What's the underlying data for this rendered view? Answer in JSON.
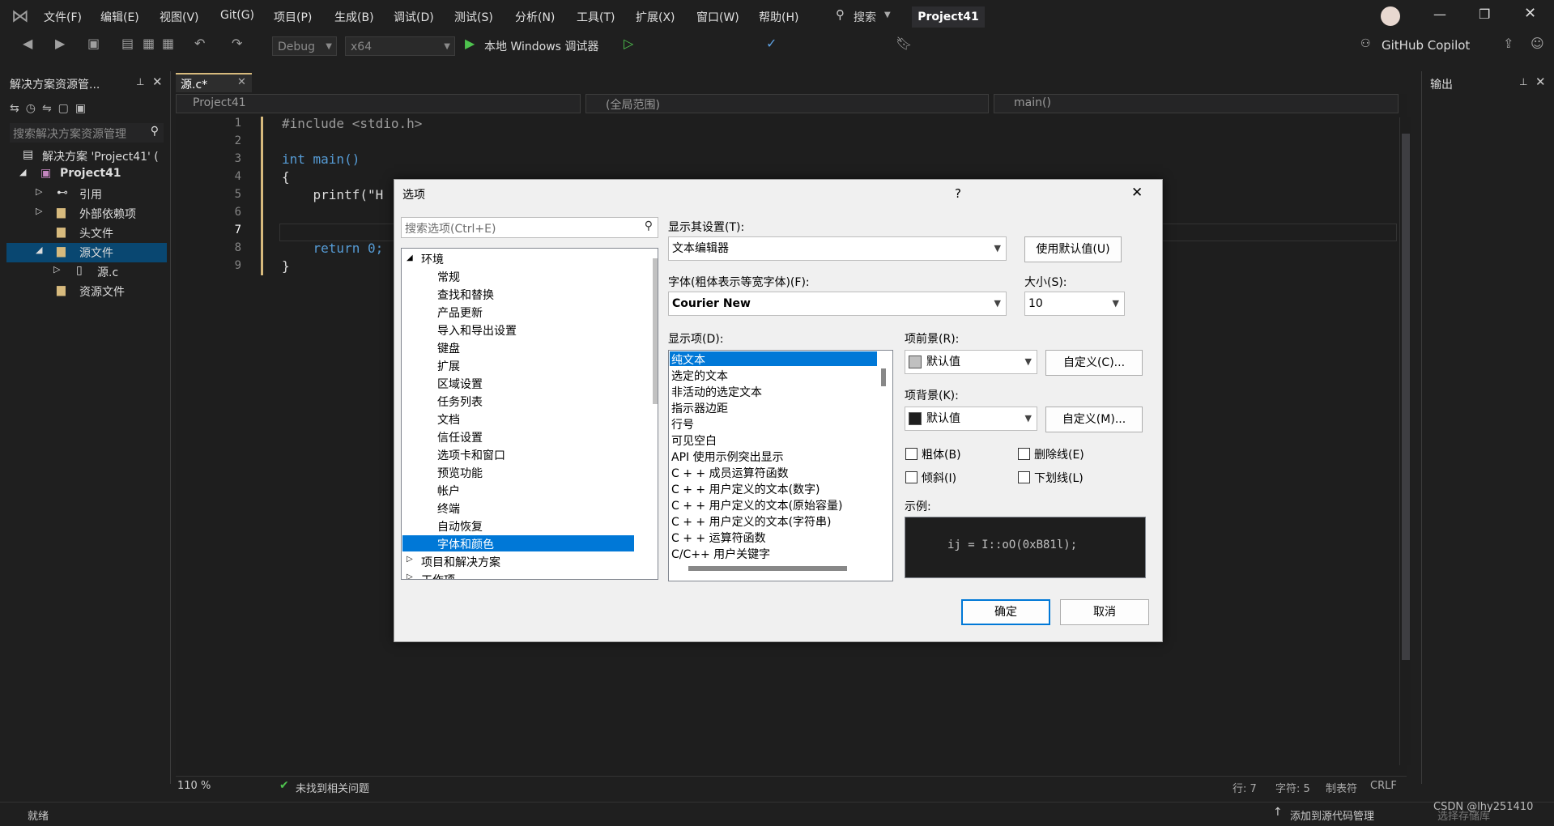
{
  "menu": [
    "文件(F)",
    "编辑(E)",
    "视图(V)",
    "Git(G)",
    "项目(P)",
    "生成(B)",
    "调试(D)",
    "测试(S)",
    "分析(N)",
    "工具(T)",
    "扩展(X)",
    "窗口(W)",
    "帮助(H)"
  ],
  "search_label": "搜索",
  "project_badge": "Project41",
  "toolbar": {
    "config": "Debug",
    "platform": "x64",
    "debugger": "本地 Windows 调试器",
    "copilot": "GitHub Copilot"
  },
  "solution_explorer": {
    "title": "解决方案资源管...",
    "search_placeholder": "搜索解决方案资源管理",
    "items": [
      {
        "label": "解决方案 'Project41' (",
        "indent": 0
      },
      {
        "label": "Project41",
        "indent": 1
      },
      {
        "label": "引用",
        "indent": 2
      },
      {
        "label": "外部依赖项",
        "indent": 2
      },
      {
        "label": "头文件",
        "indent": 2
      },
      {
        "label": "源文件",
        "indent": 2
      },
      {
        "label": "源.c",
        "indent": 3
      },
      {
        "label": "资源文件",
        "indent": 2
      }
    ]
  },
  "editor": {
    "tab": "源.c*",
    "nav_project": "Project41",
    "nav_scope": "(全局范围)",
    "nav_func": "main()",
    "lines": [
      {
        "n": "1",
        "text": "#include <stdio.h>"
      },
      {
        "n": "2",
        "text": ""
      },
      {
        "n": "3",
        "text": "int main()"
      },
      {
        "n": "4",
        "text": "{"
      },
      {
        "n": "5",
        "text": "    printf(\"H"
      },
      {
        "n": "6",
        "text": ""
      },
      {
        "n": "7",
        "text": ""
      },
      {
        "n": "8",
        "text": "    return 0;"
      },
      {
        "n": "9",
        "text": "}"
      }
    ]
  },
  "output_panel": {
    "title": "输出"
  },
  "dialog": {
    "title": "选项",
    "help": "?",
    "search_placeholder": "搜索选项(Ctrl+E)",
    "tree": [
      {
        "label": "环境",
        "level": 0,
        "expanded": true
      },
      {
        "label": "常规",
        "level": 1
      },
      {
        "label": "查找和替换",
        "level": 1
      },
      {
        "label": "产品更新",
        "level": 1
      },
      {
        "label": "导入和导出设置",
        "level": 1
      },
      {
        "label": "键盘",
        "level": 1
      },
      {
        "label": "扩展",
        "level": 1
      },
      {
        "label": "区域设置",
        "level": 1
      },
      {
        "label": "任务列表",
        "level": 1
      },
      {
        "label": "文档",
        "level": 1
      },
      {
        "label": "信任设置",
        "level": 1
      },
      {
        "label": "选项卡和窗口",
        "level": 1
      },
      {
        "label": "预览功能",
        "level": 1
      },
      {
        "label": "帐户",
        "level": 1
      },
      {
        "label": "终端",
        "level": 1
      },
      {
        "label": "自动恢复",
        "level": 1
      },
      {
        "label": "字体和颜色",
        "level": 1,
        "selected": true
      },
      {
        "label": "项目和解决方案",
        "level": 0,
        "expanded": false
      },
      {
        "label": "工作项",
        "level": 0,
        "expanded": false
      }
    ],
    "show_settings_for_label": "显示其设置(T):",
    "show_settings_for_value": "文本编辑器",
    "use_defaults": "使用默认值(U)",
    "font_label": "字体(粗体表示等宽字体)(F):",
    "font_value": "Courier New",
    "size_label": "大小(S):",
    "size_value": "10",
    "display_items_label": "显示项(D):",
    "display_items": [
      "纯文本",
      "选定的文本",
      "非活动的选定文本",
      "指示器边距",
      "行号",
      "可见空白",
      "API 使用示例突出显示",
      "C + + 成员运算符函数",
      "C + + 用户定义的文本(数字)",
      "C + + 用户定义的文本(原始容量)",
      "C + + 用户定义的文本(字符串)",
      "C + + 运算符函数",
      "C/C++ 用户关键字"
    ],
    "foreground_label": "项前景(R):",
    "foreground_value": "默认值",
    "foreground_custom": "自定义(C)...",
    "background_label": "项背景(K):",
    "background_value": "默认值",
    "background_custom": "自定义(M)...",
    "bold": "粗体(B)",
    "strikethrough": "删除线(E)",
    "italic": "倾斜(I)",
    "underline": "下划线(L)",
    "sample_label": "示例:",
    "sample_text": "ij = I::oO(0xB81l);",
    "ok": "确定",
    "cancel": "取消"
  },
  "status": {
    "zoom": "110 %",
    "issues": "未找到相关问题",
    "line": "行: 7",
    "col": "字符: 5",
    "tabs": "制表符",
    "eol": "CRLF",
    "ready": "就绪",
    "add_source": "添加到源代码管理",
    "select_repo": "选择存储库",
    "watermark": "CSDN @lhy251410"
  },
  "colors": {
    "accent": "#0078d7",
    "keyword": "#569cd6",
    "string": "#ce9178",
    "preproc": "#9b9b9b"
  }
}
